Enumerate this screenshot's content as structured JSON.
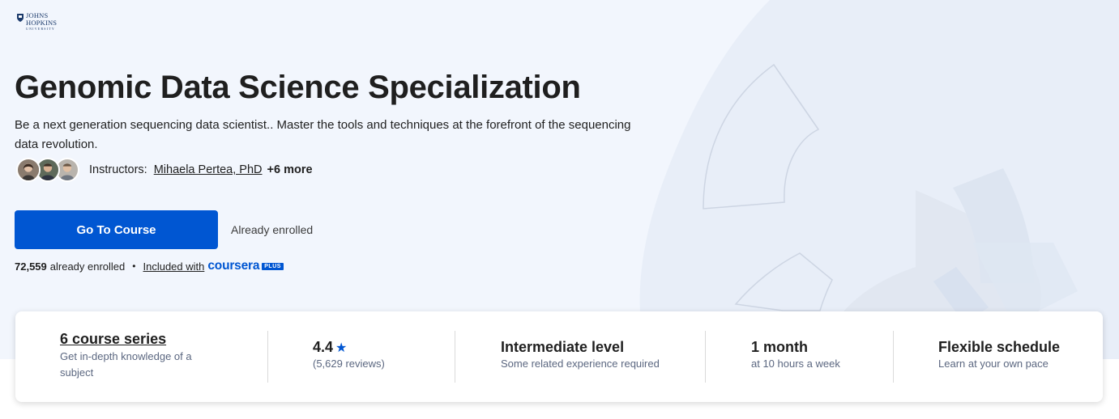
{
  "university": {
    "line1": "JOHNS",
    "line2": "HOPKINS",
    "line3": "UNIVERSITY"
  },
  "hero": {
    "title": "Genomic Data Science Specialization",
    "subtitle": "Be a next generation sequencing data scientist.. Master the tools and techniques at the forefront of the sequencing data revolution.",
    "instructors_label": "Instructors:",
    "instructor_name": "Mihaela Pertea, PhD",
    "instructors_more": "+6 more",
    "cta_label": "Go To Course",
    "enrolled_note": "Already enrolled",
    "enrolled_count": "72,559",
    "enrolled_suffix": "already enrolled",
    "separator": "•",
    "included_with": "Included with",
    "brand": "coursera",
    "brand_badge": "PLUS"
  },
  "stats": {
    "series": {
      "title": "6 course series",
      "subtitle": "Get in-depth knowledge of a subject"
    },
    "rating": {
      "value": "4.4",
      "star": "★",
      "reviews": "(5,629 reviews)"
    },
    "level": {
      "title": "Intermediate level",
      "subtitle": "Some related experience required"
    },
    "duration": {
      "title": "1 month",
      "subtitle": "at 10 hours a week"
    },
    "schedule": {
      "title": "Flexible schedule",
      "subtitle": "Learn at your own pace"
    }
  },
  "colors": {
    "accent": "#0056d2",
    "hero_bg": "#f2f6fd",
    "text": "#1f1f1f"
  },
  "icons": [
    "university-shield-icon",
    "star-icon"
  ]
}
